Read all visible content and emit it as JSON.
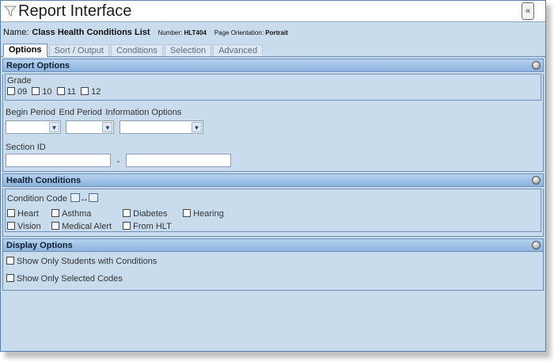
{
  "window": {
    "title": "Report Interface",
    "collapse_label": "«"
  },
  "report": {
    "name_label": "Name:",
    "name": "Class Health Conditions List",
    "number_label": "Number:",
    "number": "HLT404",
    "orientation_label": "Page Orientation:",
    "orientation": "Portrait"
  },
  "tabs": [
    {
      "label": "Options",
      "active": true
    },
    {
      "label": "Sort / Output",
      "active": false
    },
    {
      "label": "Conditions",
      "active": false
    },
    {
      "label": "Selection",
      "active": false
    },
    {
      "label": "Advanced",
      "active": false
    }
  ],
  "report_options": {
    "title": "Report Options",
    "grade_label": "Grade",
    "grades": [
      "09",
      "10",
      "11",
      "12"
    ],
    "begin_period_label": "Begin Period",
    "end_period_label": "End Period",
    "info_options_label": "Information Options",
    "section_id_label": "Section ID",
    "range_separator": "-"
  },
  "health_conditions": {
    "title": "Health Conditions",
    "condition_code_label": "Condition Code",
    "codes_row1": [
      "Heart",
      "Asthma",
      "Diabetes",
      "Hearing"
    ],
    "codes_row2": [
      "Vision",
      "Medical Alert",
      "From HLT"
    ]
  },
  "display_options": {
    "title": "Display Options",
    "options": [
      "Show Only Students with Conditions",
      "Show Only Selected Codes"
    ]
  }
}
